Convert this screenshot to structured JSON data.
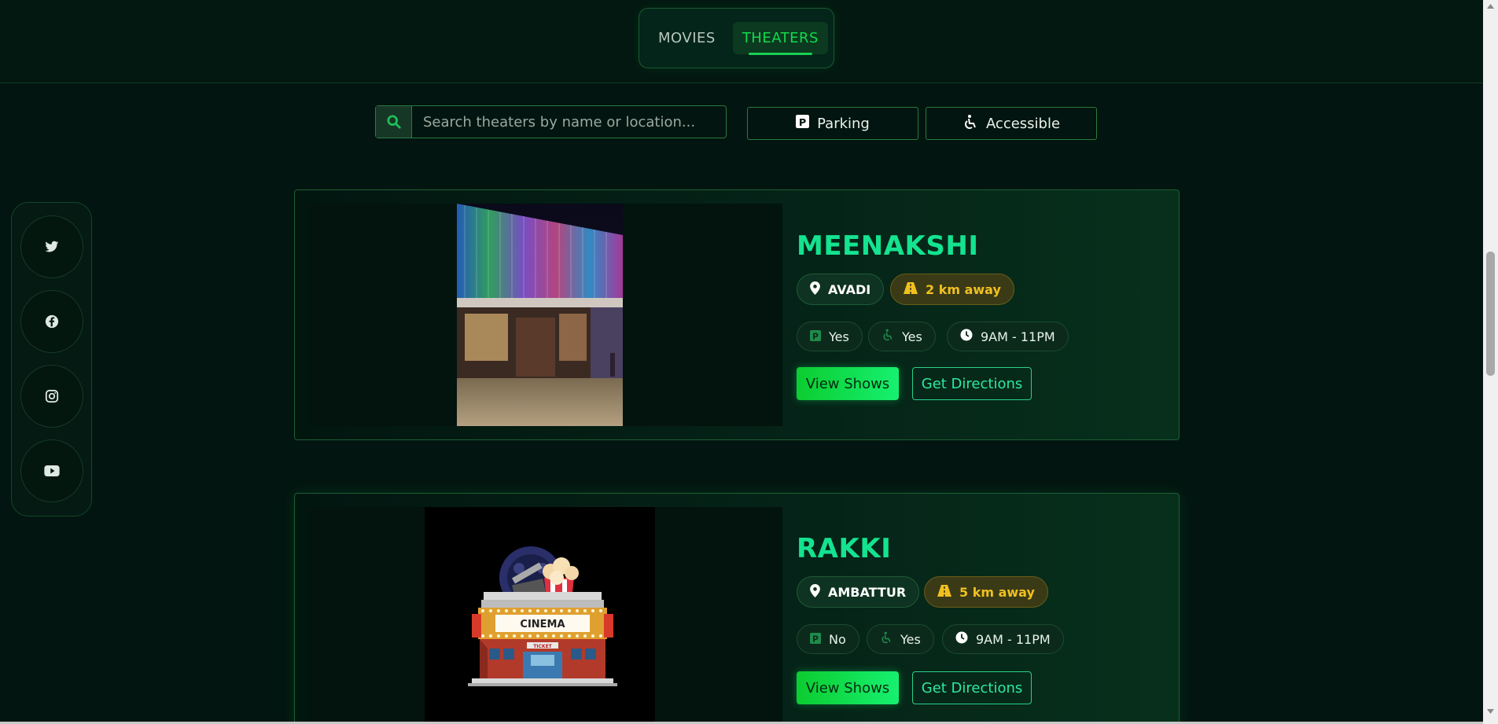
{
  "tabs": [
    {
      "label": "MOVIES"
    },
    {
      "label": "THEATERS"
    }
  ],
  "search": {
    "placeholder": "Search theaters by name or location..."
  },
  "filters": {
    "parking": "Parking",
    "accessible": "Accessible"
  },
  "social": [
    "twitter-icon",
    "facebook-icon",
    "instagram-icon",
    "youtube-icon"
  ],
  "theaters": [
    {
      "name": "MEENAKSHI",
      "location": "AVADI",
      "distance": "2 km away",
      "parking": "Yes",
      "accessible": "Yes",
      "hours": "9AM - 11PM",
      "view_label": "View Shows",
      "directions_label": "Get Directions"
    },
    {
      "name": "RAKKI",
      "location": "AMBATTUR",
      "distance": "5 km away",
      "parking": "No",
      "accessible": "Yes",
      "hours": "9AM - 11PM",
      "view_label": "View Shows",
      "directions_label": "Get Directions",
      "image_sign": "CINEMA",
      "image_ticket": "TICKET"
    }
  ],
  "colors": {
    "accent": "#14e38f",
    "background": "#031510",
    "distance": "#f0c020"
  }
}
